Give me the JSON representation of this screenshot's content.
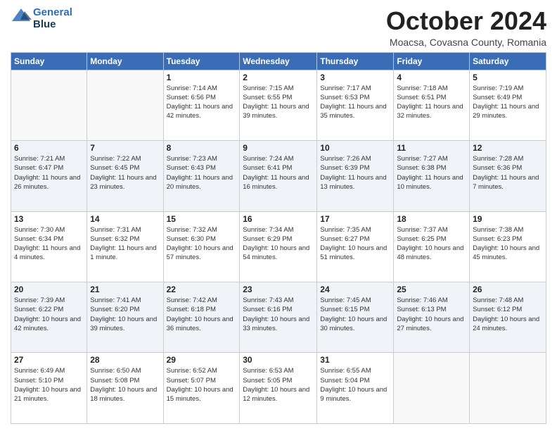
{
  "header": {
    "logo_line1": "General",
    "logo_line2": "Blue",
    "month_title": "October 2024",
    "subtitle": "Moacsa, Covasna County, Romania"
  },
  "weekdays": [
    "Sunday",
    "Monday",
    "Tuesday",
    "Wednesday",
    "Thursday",
    "Friday",
    "Saturday"
  ],
  "weeks": [
    [
      {
        "day": "",
        "info": ""
      },
      {
        "day": "",
        "info": ""
      },
      {
        "day": "1",
        "info": "Sunrise: 7:14 AM\nSunset: 6:56 PM\nDaylight: 11 hours and 42 minutes."
      },
      {
        "day": "2",
        "info": "Sunrise: 7:15 AM\nSunset: 6:55 PM\nDaylight: 11 hours and 39 minutes."
      },
      {
        "day": "3",
        "info": "Sunrise: 7:17 AM\nSunset: 6:53 PM\nDaylight: 11 hours and 35 minutes."
      },
      {
        "day": "4",
        "info": "Sunrise: 7:18 AM\nSunset: 6:51 PM\nDaylight: 11 hours and 32 minutes."
      },
      {
        "day": "5",
        "info": "Sunrise: 7:19 AM\nSunset: 6:49 PM\nDaylight: 11 hours and 29 minutes."
      }
    ],
    [
      {
        "day": "6",
        "info": "Sunrise: 7:21 AM\nSunset: 6:47 PM\nDaylight: 11 hours and 26 minutes."
      },
      {
        "day": "7",
        "info": "Sunrise: 7:22 AM\nSunset: 6:45 PM\nDaylight: 11 hours and 23 minutes."
      },
      {
        "day": "8",
        "info": "Sunrise: 7:23 AM\nSunset: 6:43 PM\nDaylight: 11 hours and 20 minutes."
      },
      {
        "day": "9",
        "info": "Sunrise: 7:24 AM\nSunset: 6:41 PM\nDaylight: 11 hours and 16 minutes."
      },
      {
        "day": "10",
        "info": "Sunrise: 7:26 AM\nSunset: 6:39 PM\nDaylight: 11 hours and 13 minutes."
      },
      {
        "day": "11",
        "info": "Sunrise: 7:27 AM\nSunset: 6:38 PM\nDaylight: 11 hours and 10 minutes."
      },
      {
        "day": "12",
        "info": "Sunrise: 7:28 AM\nSunset: 6:36 PM\nDaylight: 11 hours and 7 minutes."
      }
    ],
    [
      {
        "day": "13",
        "info": "Sunrise: 7:30 AM\nSunset: 6:34 PM\nDaylight: 11 hours and 4 minutes."
      },
      {
        "day": "14",
        "info": "Sunrise: 7:31 AM\nSunset: 6:32 PM\nDaylight: 11 hours and 1 minute."
      },
      {
        "day": "15",
        "info": "Sunrise: 7:32 AM\nSunset: 6:30 PM\nDaylight: 10 hours and 57 minutes."
      },
      {
        "day": "16",
        "info": "Sunrise: 7:34 AM\nSunset: 6:29 PM\nDaylight: 10 hours and 54 minutes."
      },
      {
        "day": "17",
        "info": "Sunrise: 7:35 AM\nSunset: 6:27 PM\nDaylight: 10 hours and 51 minutes."
      },
      {
        "day": "18",
        "info": "Sunrise: 7:37 AM\nSunset: 6:25 PM\nDaylight: 10 hours and 48 minutes."
      },
      {
        "day": "19",
        "info": "Sunrise: 7:38 AM\nSunset: 6:23 PM\nDaylight: 10 hours and 45 minutes."
      }
    ],
    [
      {
        "day": "20",
        "info": "Sunrise: 7:39 AM\nSunset: 6:22 PM\nDaylight: 10 hours and 42 minutes."
      },
      {
        "day": "21",
        "info": "Sunrise: 7:41 AM\nSunset: 6:20 PM\nDaylight: 10 hours and 39 minutes."
      },
      {
        "day": "22",
        "info": "Sunrise: 7:42 AM\nSunset: 6:18 PM\nDaylight: 10 hours and 36 minutes."
      },
      {
        "day": "23",
        "info": "Sunrise: 7:43 AM\nSunset: 6:16 PM\nDaylight: 10 hours and 33 minutes."
      },
      {
        "day": "24",
        "info": "Sunrise: 7:45 AM\nSunset: 6:15 PM\nDaylight: 10 hours and 30 minutes."
      },
      {
        "day": "25",
        "info": "Sunrise: 7:46 AM\nSunset: 6:13 PM\nDaylight: 10 hours and 27 minutes."
      },
      {
        "day": "26",
        "info": "Sunrise: 7:48 AM\nSunset: 6:12 PM\nDaylight: 10 hours and 24 minutes."
      }
    ],
    [
      {
        "day": "27",
        "info": "Sunrise: 6:49 AM\nSunset: 5:10 PM\nDaylight: 10 hours and 21 minutes."
      },
      {
        "day": "28",
        "info": "Sunrise: 6:50 AM\nSunset: 5:08 PM\nDaylight: 10 hours and 18 minutes."
      },
      {
        "day": "29",
        "info": "Sunrise: 6:52 AM\nSunset: 5:07 PM\nDaylight: 10 hours and 15 minutes."
      },
      {
        "day": "30",
        "info": "Sunrise: 6:53 AM\nSunset: 5:05 PM\nDaylight: 10 hours and 12 minutes."
      },
      {
        "day": "31",
        "info": "Sunrise: 6:55 AM\nSunset: 5:04 PM\nDaylight: 10 hours and 9 minutes."
      },
      {
        "day": "",
        "info": ""
      },
      {
        "day": "",
        "info": ""
      }
    ]
  ]
}
